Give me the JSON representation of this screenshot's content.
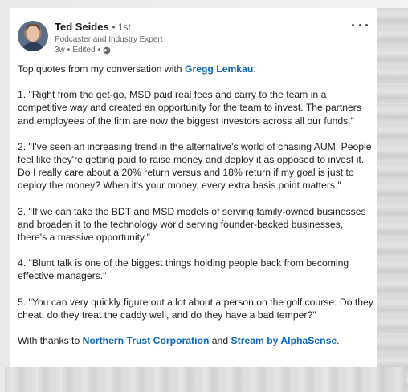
{
  "post": {
    "author": {
      "name": "Ted Seides",
      "degree": "1st",
      "headline": "Podcaster and Industry Expert",
      "time": "3w",
      "edited": "Edited"
    },
    "intro": "Top quotes from my conversation with",
    "intro_link": "Gregg Lemkau",
    "intro_end": ":",
    "quotes": [
      "1. \"Right from the get-go, MSD paid real fees and carry to the team in a competitive way and created an opportunity for the team to invest. The partners and employees of the firm are now the biggest investors across all our funds.\"",
      "2. \"I've seen an increasing trend in the alternative's world of chasing AUM. People feel like they're getting paid to raise money and deploy it as opposed to invest it. Do I really care about a 20% return versus and 18% return if my goal is just to deploy the money? When it's your money, every extra basis point matters.\"",
      "3. \"If we can take the BDT and MSD models of serving family-owned businesses and broaden it to the technology world serving founder-backed businesses, there's a massive opportunity.\"",
      "4. \"Blunt talk is one of the biggest things holding people back from becoming effective managers.\"",
      "5. \"You can very quickly figure out a lot about a person on the golf course. Do they cheat, do they treat the caddy well, and do they have a bad temper?\""
    ],
    "thanks_prefix": "With thanks to",
    "thanks_link_1": "Northern Trust Corporation",
    "thanks_and": "and",
    "thanks_link_2": "Stream by AlphaSense",
    "thanks_end": "."
  },
  "colors": {
    "link": "#0a66c2",
    "text": "#222222",
    "meta": "#666666"
  }
}
